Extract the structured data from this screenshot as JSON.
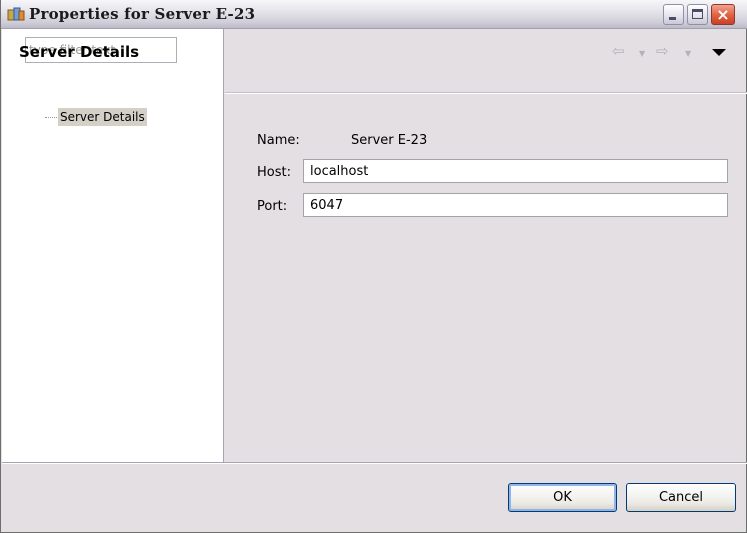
{
  "window": {
    "title": "Properties for Server E-23",
    "controls": {
      "minimize": "minimize",
      "maximize": "maximize",
      "close": "×"
    }
  },
  "nav": {
    "filter_placeholder": "type filter text",
    "items": [
      {
        "label": "Server Details",
        "selected": true
      }
    ]
  },
  "page": {
    "title": "Server Details",
    "history": {
      "back": "⇦",
      "forward": "⇨",
      "dropdown": "▼"
    },
    "fields": {
      "name_label": "Name:",
      "name_value": "Server E-23",
      "host_label": "Host:",
      "host_value": "localhost",
      "port_label": "Port:",
      "port_value": "6047"
    }
  },
  "buttons": {
    "ok": "OK",
    "cancel": "Cancel"
  },
  "colors": {
    "selection": "#d4d0c8",
    "window_bg": "#e4dfe3",
    "close_button": "#e0603f"
  }
}
